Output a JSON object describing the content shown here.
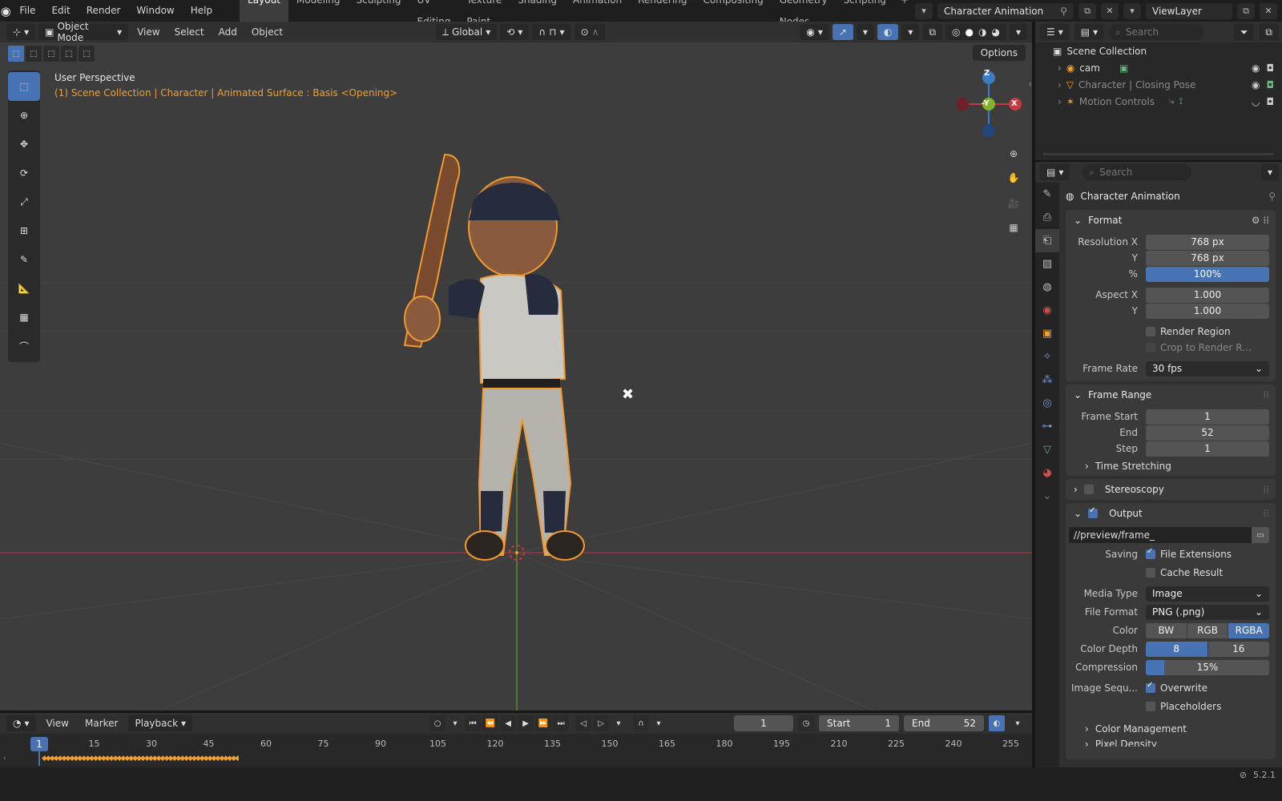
{
  "menu": [
    "File",
    "Edit",
    "Render",
    "Window",
    "Help"
  ],
  "workspaces": [
    "Layout",
    "Modeling",
    "Sculpting",
    "UV Editing",
    "Texture Paint",
    "Shading",
    "Animation",
    "Rendering",
    "Compositing",
    "Geometry Nodes",
    "Scripting"
  ],
  "active_workspace": "Layout",
  "scene_name": "Character Animation",
  "view_layer": "ViewLayer",
  "viewport": {
    "mode": "Object Mode",
    "menus": [
      "View",
      "Select",
      "Add",
      "Object"
    ],
    "orientation": "Global",
    "options_label": "Options",
    "perspective": "User Perspective",
    "context": "(1) Scene Collection | Character | Animated Surface : Basis <Opening>",
    "gizmo": {
      "z": "Z",
      "y": "-Y",
      "x": "X"
    }
  },
  "timeline": {
    "menus": [
      "View",
      "Marker"
    ],
    "playback": "Playback",
    "current_frame": "1",
    "start_label": "Start",
    "start": "1",
    "end_label": "End",
    "end": "52",
    "ticks": [
      "1",
      "15",
      "30",
      "45",
      "60",
      "75",
      "90",
      "105",
      "120",
      "135",
      "150",
      "165",
      "180",
      "195",
      "210",
      "225",
      "240",
      "255"
    ]
  },
  "status": {
    "version": "5.2.1"
  },
  "outliner": {
    "search_placeholder": "Search",
    "root": "Scene Collection",
    "items": [
      {
        "name": "cam",
        "dim": false
      },
      {
        "name": "Character | Closing Pose",
        "dim": true
      },
      {
        "name": "Motion Controls",
        "dim": true
      }
    ]
  },
  "properties": {
    "search_placeholder": "Search",
    "context": "Character Animation",
    "format": {
      "title": "Format",
      "res_x_label": "Resolution X",
      "res_x": "768 px",
      "res_y_label": "Y",
      "res_y": "768 px",
      "pct_label": "%",
      "pct": "100%",
      "aspect_x_label": "Aspect X",
      "aspect_x": "1.000",
      "aspect_y_label": "Y",
      "aspect_y": "1.000",
      "render_region": "Render Region",
      "crop": "Crop to Render R...",
      "frame_rate_label": "Frame Rate",
      "frame_rate": "30 fps"
    },
    "frame_range": {
      "title": "Frame Range",
      "start_label": "Frame Start",
      "start": "1",
      "end_label": "End",
      "end": "52",
      "step_label": "Step",
      "step": "1",
      "time_stretching": "Time Stretching"
    },
    "stereoscopy": "Stereoscopy",
    "output": {
      "title": "Output",
      "path": "//preview/frame_",
      "saving_label": "Saving",
      "file_extensions": "File Extensions",
      "cache_result": "Cache Result",
      "media_type_label": "Media Type",
      "media_type": "Image",
      "file_format_label": "File Format",
      "file_format": "PNG (.png)",
      "color_label": "Color",
      "color_opts": [
        "BW",
        "RGB",
        "RGBA"
      ],
      "depth_label": "Color Depth",
      "depth_opts": [
        "8",
        "16"
      ],
      "compression_label": "Compression",
      "compression": "15%",
      "image_seq_label": "Image Sequ...",
      "overwrite": "Overwrite",
      "placeholders": "Placeholders",
      "color_management": "Color Management",
      "pixel_density": "Pixel Density"
    }
  },
  "colors": {
    "accent": "#4772b3",
    "selection": "#f0a030",
    "axis_x": "#c53a45",
    "axis_y": "#7fb32b",
    "axis_z": "#3d7ac4"
  }
}
